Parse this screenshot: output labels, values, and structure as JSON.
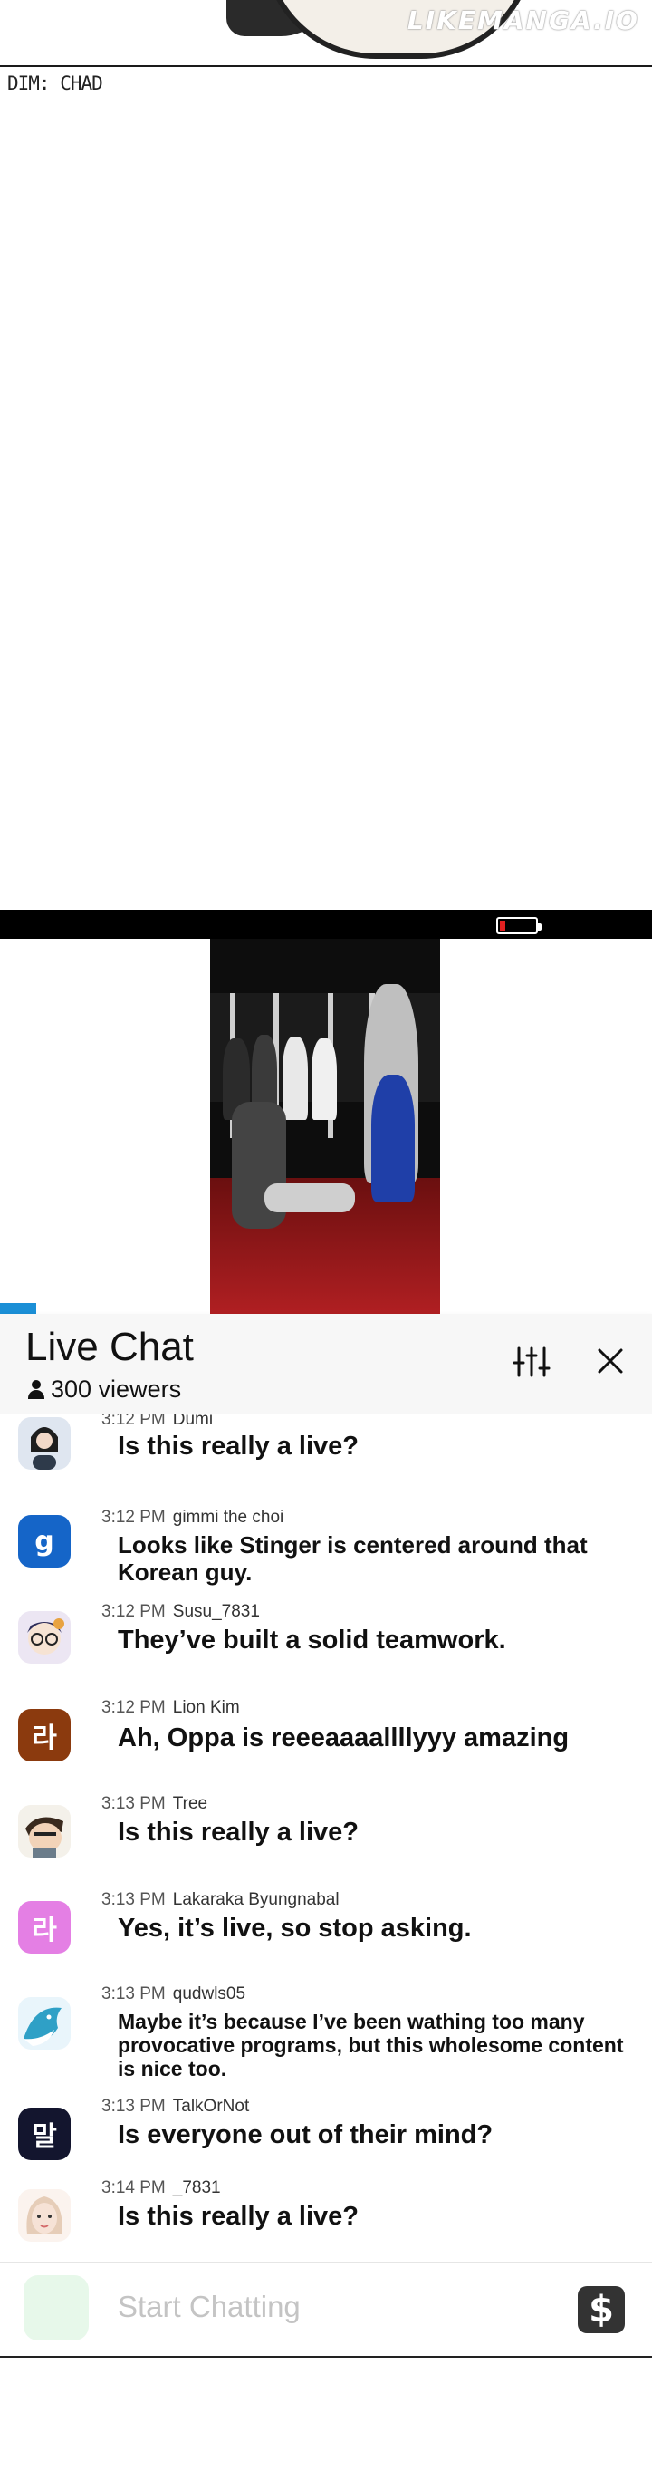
{
  "watermark": "LIKEMANGA.IO",
  "caption": "DIM: CHAD",
  "live_chat": {
    "title": "Live Chat",
    "viewers": "300 viewers"
  },
  "messages": [
    {
      "time": "3:12 PM",
      "user": "Dumi",
      "text": "Is this really a live?",
      "avatar_color": "#cfd8e6",
      "avatar_char": ""
    },
    {
      "time": "3:12 PM",
      "user": "gimmi the choi",
      "text": "Looks like Stinger is centered around that Korean guy.",
      "avatar_color": "#1565c8",
      "avatar_char": "g"
    },
    {
      "time": "3:12 PM",
      "user": "Susu_7831",
      "text": "They’ve built a solid teamwork.",
      "avatar_color": "#e9e2f2",
      "avatar_char": ""
    },
    {
      "time": "3:12 PM",
      "user": "Lion Kim",
      "text": "Ah, Oppa is reeeaaaallllyyy amazing",
      "avatar_color": "#8b3a0e",
      "avatar_char": "라"
    },
    {
      "time": "3:13 PM",
      "user": "Tree",
      "text": "Is this really a live?",
      "avatar_color": "#d9cbb8",
      "avatar_char": ""
    },
    {
      "time": "3:13 PM",
      "user": "Lakaraka Byungnabal",
      "text": "Yes, it’s live, so stop asking.",
      "avatar_color": "#e47fe4",
      "avatar_char": "라"
    },
    {
      "time": "3:13 PM",
      "user": "qudwls05",
      "text": "Maybe it’s because I’ve been wathing too many provocative programs, but this wholesome content is nice too.",
      "avatar_color": "#36a3c9",
      "avatar_char": ""
    },
    {
      "time": "3:13 PM",
      "user": "TalkOrNot",
      "text": "Is everyone out of their mind?",
      "avatar_color": "#13152e",
      "avatar_char": "말"
    },
    {
      "time": "3:14 PM",
      "user": "_7831",
      "text": "Is this really a live?",
      "avatar_color": "#f3e6df",
      "avatar_char": ""
    }
  ],
  "input": {
    "placeholder": "Start Chatting",
    "donate_symbol": "$"
  }
}
